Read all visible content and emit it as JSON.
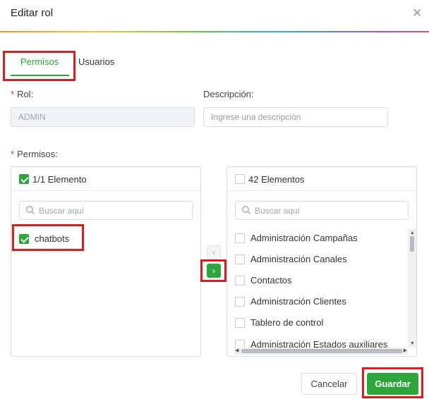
{
  "dialog": {
    "title": "Editar rol",
    "close_icon": "close-icon"
  },
  "tabs": [
    {
      "label": "Permisos",
      "active": true
    },
    {
      "label": "Usuarios",
      "active": false
    }
  ],
  "form": {
    "rol_label": "Rol",
    "rol_value": "ADMIN",
    "descripcion_label": "Descripción",
    "descripcion_placeholder": "Ingrese una descripción",
    "permisos_label": "Permisos",
    "required_mark": "*",
    "colon": ":"
  },
  "transfer": {
    "left": {
      "count_label": "1/1 Elemento",
      "search_placeholder": "Buscar aquí",
      "items": [
        {
          "label": "chatbots",
          "checked": true
        }
      ]
    },
    "right": {
      "count_label": "42 Elementos",
      "search_placeholder": "Buscar aquí",
      "items": [
        {
          "label": "Administración Campañas",
          "checked": false
        },
        {
          "label": "Administración Canales",
          "checked": false
        },
        {
          "label": "Contactos",
          "checked": false
        },
        {
          "label": "Administración Clientes",
          "checked": false
        },
        {
          "label": "Tablero de control",
          "checked": false
        },
        {
          "label": "Administración Estados auxiliares",
          "checked": false
        }
      ]
    },
    "move_left_glyph": "‹",
    "move_right_glyph": "›"
  },
  "footer": {
    "cancel_label": "Cancelar",
    "save_label": "Guardar"
  },
  "colors": {
    "accent": "#2ca63a",
    "highlight": "#e01b1b",
    "required": "#e0303a"
  }
}
